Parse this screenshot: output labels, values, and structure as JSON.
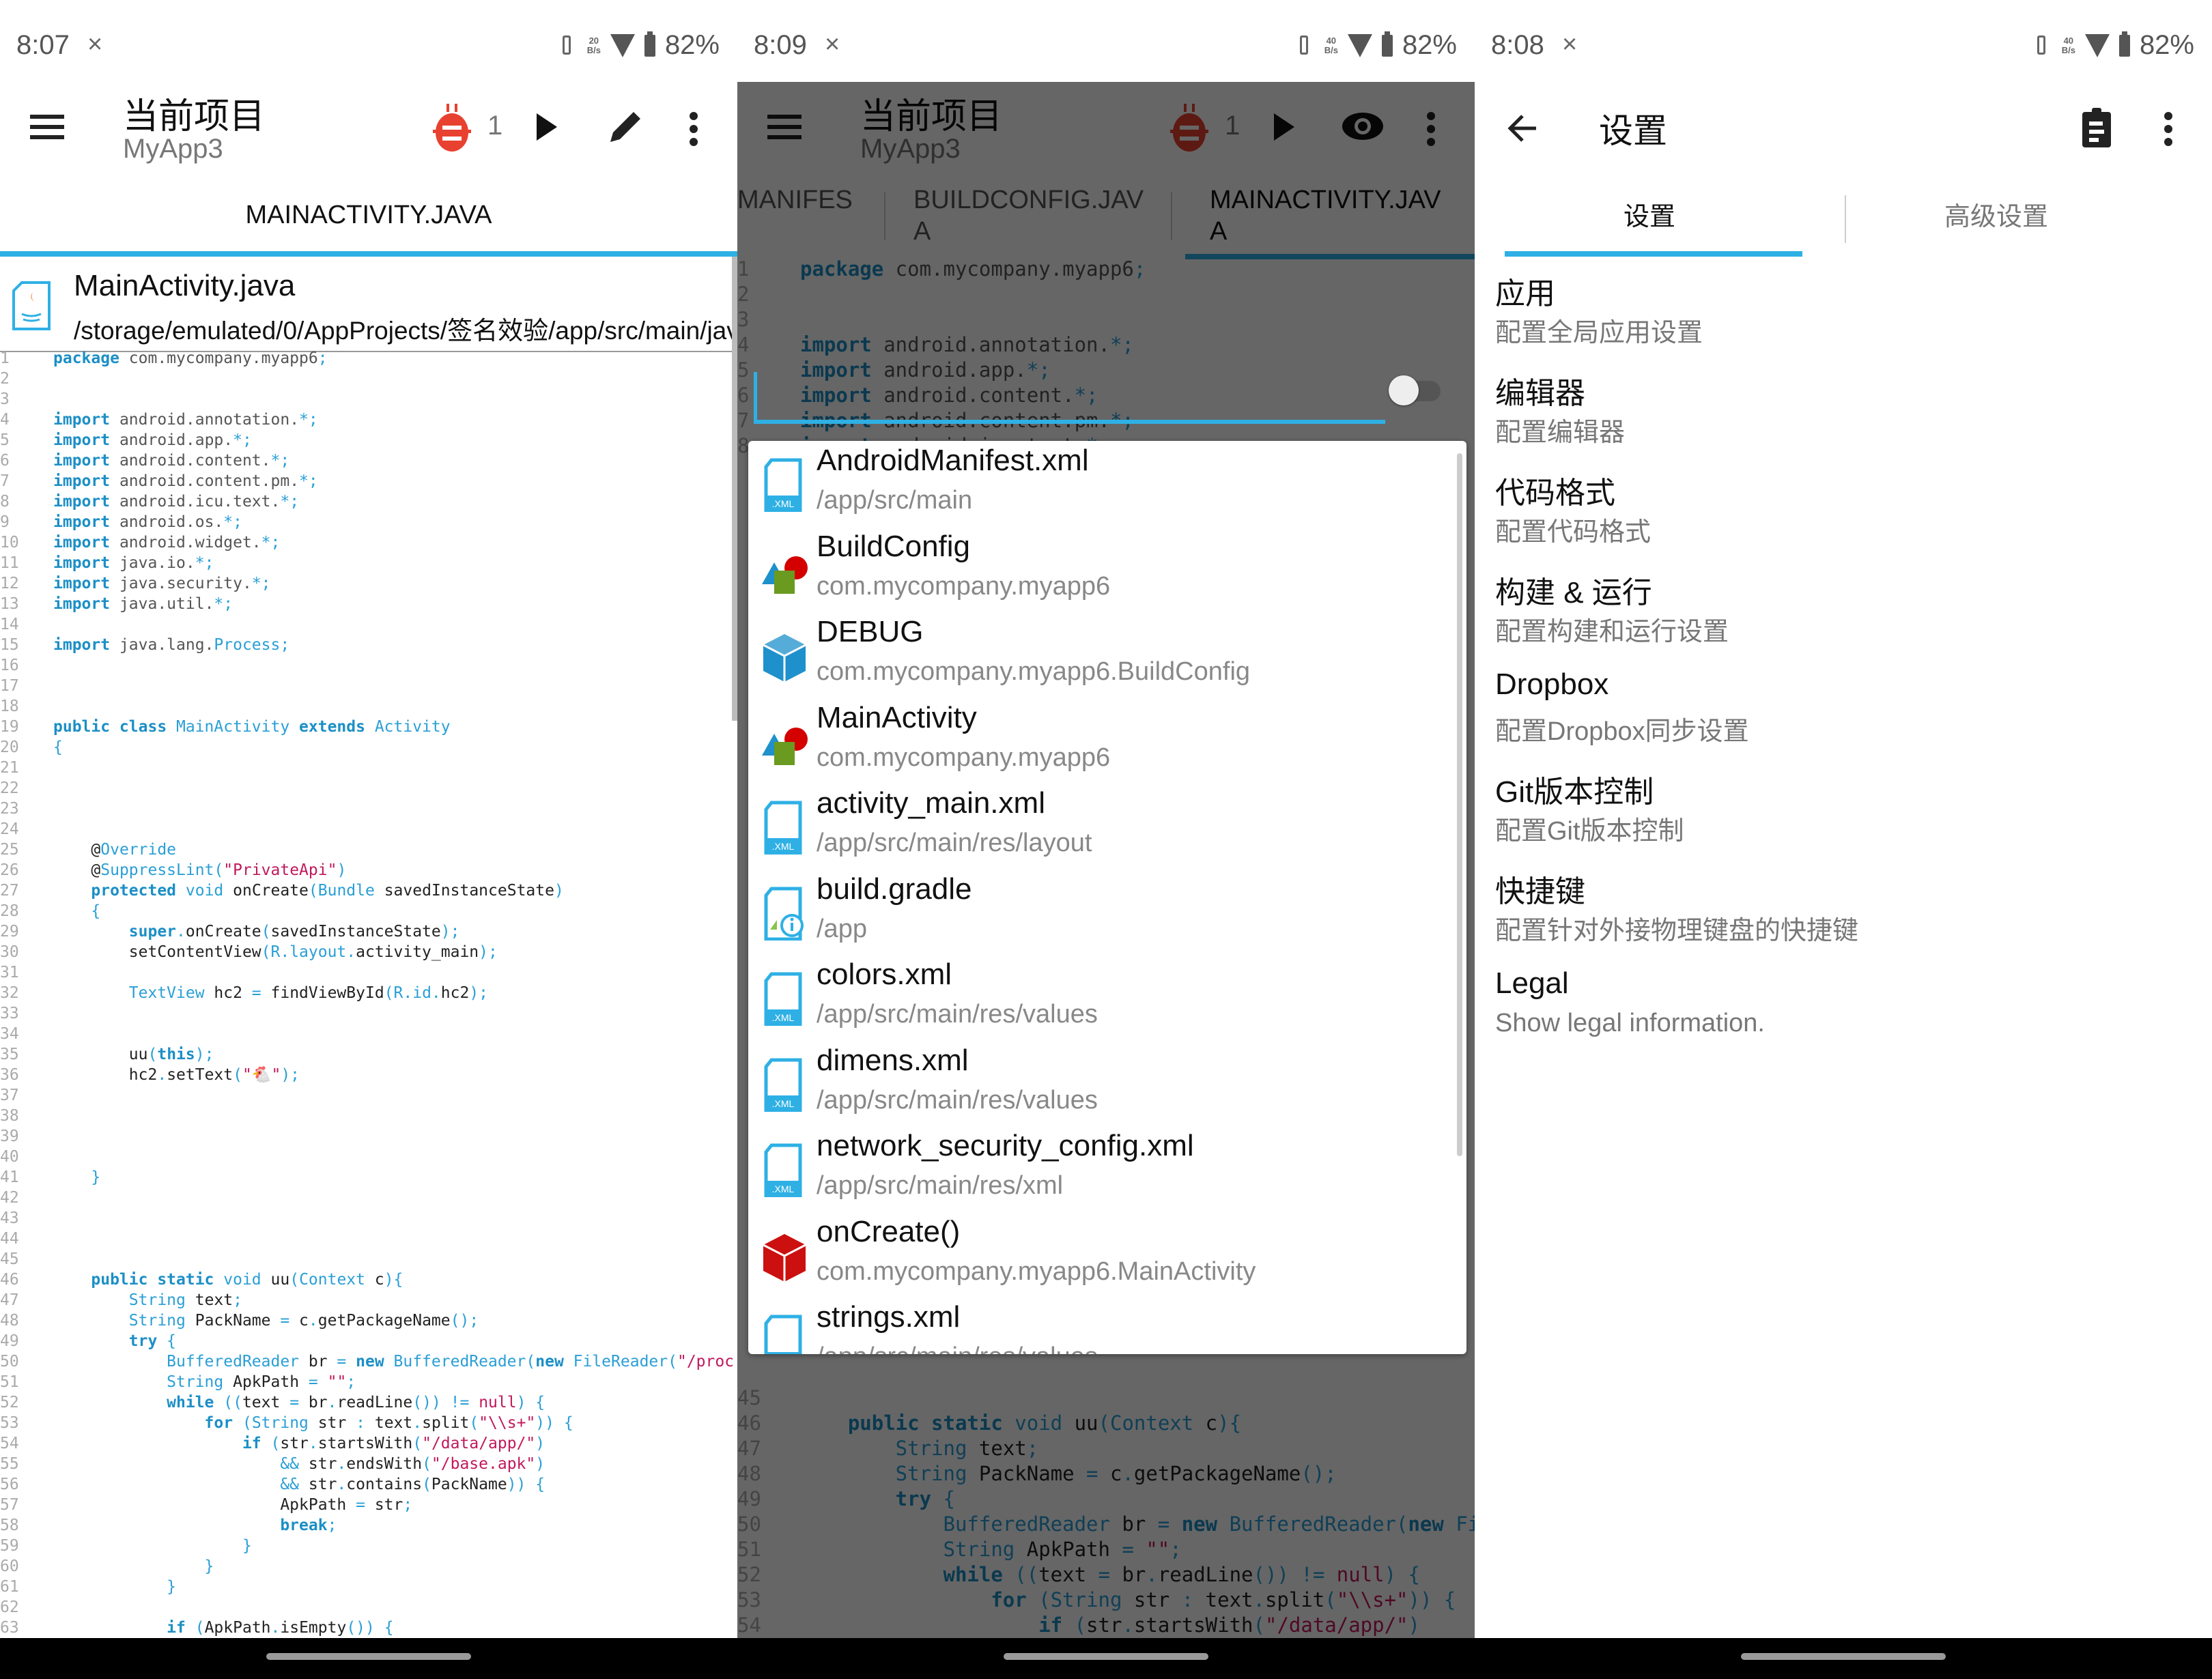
{
  "panels": [
    {
      "status": {
        "time": "8:07",
        "notification": "×",
        "net_speed_top": "20",
        "net_speed_unit": "B/s",
        "battery": "82%"
      },
      "toolbar": {
        "title": "当前项目",
        "subtitle": "MyApp3",
        "error_count": "1",
        "icons": [
          "menu-icon",
          "bug-icon",
          "play-icon",
          "pencil-icon",
          "more-vert-icon"
        ]
      },
      "tab": "MAINACTIVITY.JAVA",
      "file": {
        "name": "MainActivity.java",
        "path": "/storage/emulated/0/AppProjects/签名效验/app/src/main/jav"
      }
    },
    {
      "status": {
        "time": "8:09",
        "notification": "×",
        "net_speed_top": "40",
        "net_speed_unit": "B/s",
        "battery": "82%"
      },
      "toolbar": {
        "title": "当前项目",
        "subtitle": "MyApp3",
        "error_count": "1",
        "icons": [
          "menu-icon",
          "bug-icon",
          "play-icon",
          "eye-icon",
          "more-vert-icon"
        ]
      },
      "tabs": [
        {
          "label": "MANIFES",
          "active": false
        },
        {
          "label": "BUILDCONFIG.JAV\nA",
          "active": false
        },
        {
          "label": "MAINACTIVITY.JAV\nA",
          "active": true
        }
      ],
      "toggle": {
        "on": false
      },
      "popup_items": [
        {
          "name": "AndroidManifest.xml",
          "path": "/app/src/main",
          "icon": "xml-file-icon"
        },
        {
          "name": "BuildConfig",
          "path": "com.mycompany.myapp6",
          "icon": "class-icon"
        },
        {
          "name": "DEBUG",
          "path": "com.mycompany.myapp6.BuildConfig",
          "icon": "field-icon"
        },
        {
          "name": "MainActivity",
          "path": "com.mycompany.myapp6",
          "icon": "class-icon"
        },
        {
          "name": "activity_main.xml",
          "path": "/app/src/main/res/layout",
          "icon": "xml-file-icon"
        },
        {
          "name": "build.gradle",
          "path": "/app",
          "icon": "gradle-file-icon"
        },
        {
          "name": "colors.xml",
          "path": "/app/src/main/res/values",
          "icon": "xml-file-icon"
        },
        {
          "name": "dimens.xml",
          "path": "/app/src/main/res/values",
          "icon": "xml-file-icon"
        },
        {
          "name": "network_security_config.xml",
          "path": "/app/src/main/res/xml",
          "icon": "xml-file-icon"
        },
        {
          "name": "onCreate()",
          "path": "com.mycompany.myapp6.MainActivity",
          "icon": "method-icon"
        },
        {
          "name": "strings.xml",
          "path": "/app/src/main/res/values",
          "icon": "xml-file-icon"
        }
      ]
    },
    {
      "status": {
        "time": "8:08",
        "notification": "×",
        "net_speed_top": "40",
        "net_speed_unit": "B/s",
        "battery": "82%"
      },
      "toolbar": {
        "title": "设置",
        "icons": [
          "back-arrow-icon",
          "clipboard-icon",
          "more-vert-icon"
        ]
      },
      "tabs": [
        {
          "label": "设置",
          "active": true
        },
        {
          "label": "高级设置",
          "active": false
        }
      ],
      "settings": [
        {
          "title": "应用",
          "desc": "配置全局应用设置"
        },
        {
          "title": "编辑器",
          "desc": "配置编辑器"
        },
        {
          "title": "代码格式",
          "desc": "配置代码格式"
        },
        {
          "title": "构建 & 运行",
          "desc": "配置构建和运行设置"
        },
        {
          "title": "Dropbox",
          "desc": "配置Dropbox同步设置"
        },
        {
          "title": "Git版本控制",
          "desc": "配置Git版本控制"
        },
        {
          "title": "快捷键",
          "desc": "配置针对外接物理键盘的快捷键"
        },
        {
          "title": "Legal",
          "desc": "Show legal information."
        }
      ]
    }
  ],
  "colors": {
    "accent": "#2eb0e5",
    "bug": "#e8412f",
    "keyword": "#1c8fc6",
    "string": "#c2185b"
  },
  "code_lines": [
    [
      [
        "k",
        "package"
      ],
      [
        "d",
        " com.mycompany.myapp6"
      ],
      [
        "p",
        ";"
      ]
    ],
    [],
    [],
    [
      [
        "k",
        "import"
      ],
      [
        "d",
        " android.annotation."
      ],
      [
        "p",
        "*;"
      ]
    ],
    [
      [
        "k",
        "import"
      ],
      [
        "d",
        " android.app."
      ],
      [
        "p",
        "*;"
      ]
    ],
    [
      [
        "k",
        "import"
      ],
      [
        "d",
        " android.content."
      ],
      [
        "p",
        "*;"
      ]
    ],
    [
      [
        "k",
        "import"
      ],
      [
        "d",
        " android.content.pm."
      ],
      [
        "p",
        "*;"
      ]
    ],
    [
      [
        "k",
        "import"
      ],
      [
        "d",
        " android.icu.text."
      ],
      [
        "p",
        "*;"
      ]
    ],
    [
      [
        "k",
        "import"
      ],
      [
        "d",
        " android.os."
      ],
      [
        "p",
        "*;"
      ]
    ],
    [
      [
        "k",
        "import"
      ],
      [
        "d",
        " android.widget."
      ],
      [
        "p",
        "*;"
      ]
    ],
    [
      [
        "k",
        "import"
      ],
      [
        "d",
        " java.io."
      ],
      [
        "p",
        "*;"
      ]
    ],
    [
      [
        "k",
        "import"
      ],
      [
        "d",
        " java.security."
      ],
      [
        "p",
        "*;"
      ]
    ],
    [
      [
        "k",
        "import"
      ],
      [
        "d",
        " java.util."
      ],
      [
        "p",
        "*;"
      ]
    ],
    [],
    [
      [
        "k",
        "import"
      ],
      [
        "d",
        " java.lang."
      ],
      [
        "t",
        "Process"
      ],
      [
        "p",
        ";"
      ]
    ],
    [],
    [],
    [],
    [
      [
        "k",
        "public class "
      ],
      [
        "t",
        "MainActivity "
      ],
      [
        "k",
        "extends "
      ],
      [
        "t",
        "Activity"
      ]
    ],
    [
      [
        "p",
        "{"
      ]
    ],
    [],
    [],
    [],
    [],
    [
      [
        "n",
        "    @"
      ],
      [
        "t",
        "Override"
      ]
    ],
    [
      [
        "n",
        "    @"
      ],
      [
        "t",
        "SuppressLint"
      ],
      [
        "p",
        "("
      ],
      [
        "s",
        "\"PrivateApi\""
      ],
      [
        "p",
        ")"
      ]
    ],
    [
      [
        "k",
        "    protected "
      ],
      [
        "t",
        "void "
      ],
      [
        "n",
        "onCreate"
      ],
      [
        "p",
        "("
      ],
      [
        "t",
        "Bundle "
      ],
      [
        "n",
        "savedInstanceState"
      ],
      [
        "p",
        ")"
      ]
    ],
    [
      [
        "p",
        "    {"
      ]
    ],
    [
      [
        "k",
        "        super"
      ],
      [
        "p",
        "."
      ],
      [
        "n",
        "onCreate"
      ],
      [
        "p",
        "("
      ],
      [
        "n",
        "savedInstanceState"
      ],
      [
        "p",
        ");"
      ]
    ],
    [
      [
        "n",
        "        setContentView"
      ],
      [
        "p",
        "("
      ],
      [
        "t",
        "R.layout."
      ],
      [
        "n",
        "activity_main"
      ],
      [
        "p",
        ");"
      ]
    ],
    [],
    [
      [
        "t",
        "        TextView "
      ],
      [
        "n",
        "hc2 "
      ],
      [
        "p",
        "= "
      ],
      [
        "n",
        "findViewById"
      ],
      [
        "p",
        "("
      ],
      [
        "t",
        "R.id."
      ],
      [
        "n",
        "hc2"
      ],
      [
        "p",
        ");"
      ]
    ],
    [],
    [],
    [
      [
        "n",
        "        uu"
      ],
      [
        "p",
        "("
      ],
      [
        "k",
        "this"
      ],
      [
        "p",
        ");"
      ]
    ],
    [
      [
        "n",
        "        hc2"
      ],
      [
        "p",
        "."
      ],
      [
        "n",
        "setText"
      ],
      [
        "p",
        "("
      ],
      [
        "s",
        "\"🐔\""
      ],
      [
        "p",
        ");"
      ]
    ],
    [],
    [],
    [],
    [],
    [
      [
        "p",
        "    }"
      ]
    ],
    [],
    [],
    [],
    [],
    [
      [
        "k",
        "    public static "
      ],
      [
        "t",
        "void "
      ],
      [
        "n",
        "uu"
      ],
      [
        "p",
        "("
      ],
      [
        "t",
        "Context "
      ],
      [
        "n",
        "c"
      ],
      [
        "p",
        "){"
      ]
    ],
    [
      [
        "t",
        "        String "
      ],
      [
        "n",
        "text"
      ],
      [
        "p",
        ";"
      ]
    ],
    [
      [
        "t",
        "        String "
      ],
      [
        "n",
        "PackName "
      ],
      [
        "p",
        "= "
      ],
      [
        "n",
        "c"
      ],
      [
        "p",
        "."
      ],
      [
        "n",
        "getPackageName"
      ],
      [
        "p",
        "();"
      ]
    ],
    [
      [
        "k",
        "        try "
      ],
      [
        "p",
        "{"
      ]
    ],
    [
      [
        "t",
        "            BufferedReader "
      ],
      [
        "n",
        "br "
      ],
      [
        "p",
        "= "
      ],
      [
        "k",
        "new "
      ],
      [
        "t",
        "BufferedReader"
      ],
      [
        "p",
        "("
      ],
      [
        "k",
        "new "
      ],
      [
        "t",
        "FileReader"
      ],
      [
        "p",
        "("
      ],
      [
        "s",
        "\"/proc"
      ]
    ],
    [
      [
        "t",
        "            String "
      ],
      [
        "n",
        "ApkPath "
      ],
      [
        "p",
        "= "
      ],
      [
        "s",
        "\"\""
      ],
      [
        "p",
        ";"
      ]
    ],
    [
      [
        "k",
        "            while "
      ],
      [
        "p",
        "(("
      ],
      [
        "n",
        "text "
      ],
      [
        "p",
        "= "
      ],
      [
        "n",
        "br"
      ],
      [
        "p",
        "."
      ],
      [
        "n",
        "readLine"
      ],
      [
        "p",
        "()) != "
      ],
      [
        "s",
        "null"
      ],
      [
        "p",
        ") {"
      ]
    ],
    [
      [
        "k",
        "                for "
      ],
      [
        "p",
        "("
      ],
      [
        "t",
        "String "
      ],
      [
        "n",
        "str "
      ],
      [
        "p",
        ": "
      ],
      [
        "n",
        "text"
      ],
      [
        "p",
        "."
      ],
      [
        "n",
        "split"
      ],
      [
        "p",
        "("
      ],
      [
        "s",
        "\"\\\\s+\""
      ],
      [
        "p",
        ")) {"
      ]
    ],
    [
      [
        "k",
        "                    if "
      ],
      [
        "p",
        "("
      ],
      [
        "n",
        "str"
      ],
      [
        "p",
        "."
      ],
      [
        "n",
        "startsWith"
      ],
      [
        "p",
        "("
      ],
      [
        "s",
        "\"/data/app/\""
      ],
      [
        "p",
        ")"
      ]
    ],
    [
      [
        "p",
        "                        && "
      ],
      [
        "n",
        "str"
      ],
      [
        "p",
        "."
      ],
      [
        "n",
        "endsWith"
      ],
      [
        "p",
        "("
      ],
      [
        "s",
        "\"/base.apk\""
      ],
      [
        "p",
        ")"
      ]
    ],
    [
      [
        "p",
        "                        && "
      ],
      [
        "n",
        "str"
      ],
      [
        "p",
        "."
      ],
      [
        "n",
        "contains"
      ],
      [
        "p",
        "("
      ],
      [
        "n",
        "PackName"
      ],
      [
        "p",
        ")) {"
      ]
    ],
    [
      [
        "n",
        "                        ApkPath "
      ],
      [
        "p",
        "= "
      ],
      [
        "n",
        "str"
      ],
      [
        "p",
        ";"
      ]
    ],
    [
      [
        "k",
        "                        break"
      ],
      [
        "p",
        ";"
      ]
    ],
    [
      [
        "p",
        "                    }"
      ]
    ],
    [
      [
        "p",
        "                }"
      ]
    ],
    [
      [
        "p",
        "            }"
      ]
    ],
    [],
    [
      [
        "k",
        "            if "
      ],
      [
        "p",
        "("
      ],
      [
        "n",
        "ApkPath"
      ],
      [
        "p",
        "."
      ],
      [
        "n",
        "isEmpty"
      ],
      [
        "p",
        "()) {"
      ]
    ]
  ]
}
